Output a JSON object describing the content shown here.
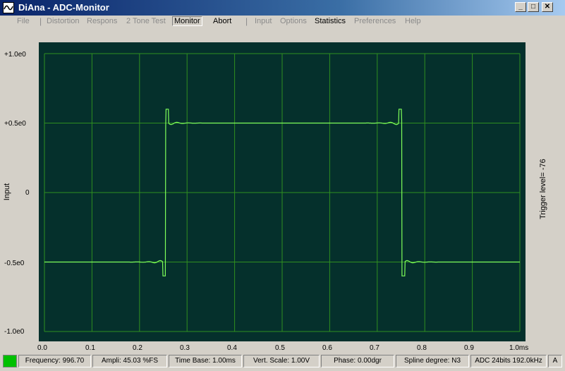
{
  "window": {
    "title": "DiAna - ADC-Monitor",
    "controls": {
      "minimize": "_",
      "maximize": "□",
      "close": "✕"
    }
  },
  "menu": {
    "file": "File",
    "sep1": "|",
    "distortion": "Distortion",
    "respons": "Respons",
    "two_tone": "2 Tone Test",
    "monitor": "Monitor",
    "abort": "Abort",
    "sep2": "|",
    "input": "Input",
    "options": "Options",
    "statistics": "Statistics",
    "preferences": "Preferences",
    "help": "Help"
  },
  "plot": {
    "y_axis_title": "Input",
    "trigger_text": "Trigger level= -76",
    "y_ticks": [
      "+1.0e0",
      "+0.5e0",
      "0",
      "-0.5e0",
      "-1.0e0"
    ],
    "x_ticks": [
      "0.0",
      "0.1",
      "0.2",
      "0.3",
      "0.4",
      "0.5",
      "0.6",
      "0.7",
      "0.8",
      "0.9",
      "1.0ms"
    ],
    "colors": {
      "background": "#05302c",
      "grid": "#2f8f20",
      "trace": "#7fff5a"
    }
  },
  "chart_data": {
    "type": "line",
    "x_range": [
      0,
      1.0
    ],
    "y_range": [
      -1.0,
      1.0
    ],
    "grid": true,
    "series": [
      {
        "x": [
          0.0,
          0.15,
          0.245,
          0.252,
          0.258,
          0.265,
          0.74,
          0.748,
          0.755,
          0.76,
          0.85,
          1.0
        ],
        "values": [
          -0.5,
          -0.5,
          -0.5,
          -0.6,
          0.6,
          0.5,
          0.5,
          0.6,
          -0.6,
          -0.5,
          -0.5,
          -0.5
        ]
      }
    ]
  },
  "status": {
    "frequency": "Frequency: 996.70",
    "ampli": "Ampli: 45.03 %FS",
    "time_base": "Time Base: 1.00ms",
    "vert_scale": "Vert. Scale: 1.00V",
    "phase": "Phase:   0.00dgr",
    "spline": "Spline degree: N3",
    "adc": "ADC 24bits 192.0kHz",
    "mode": "A"
  }
}
